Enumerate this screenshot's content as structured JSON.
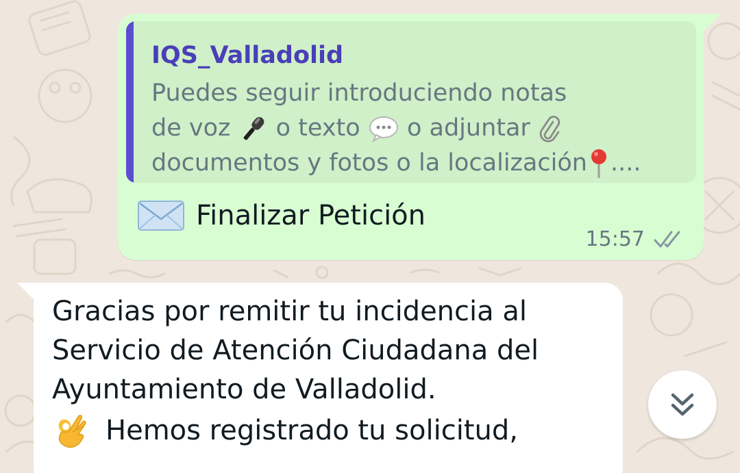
{
  "chat": {
    "outgoing": {
      "quoted_author": "IQS_Valladolid",
      "quoted_lines": [
        "Puedes seguir introduciendo notas",
        "de voz",
        "o texto",
        "o adjuntar",
        "documentos y fotos o la localización",
        "...."
      ],
      "message_text": "Finalizar Petición",
      "time": "15:57",
      "status_icon": "double-check-icon"
    },
    "incoming": {
      "lines": [
        "Gracias por remitir tu incidencia al",
        "Servicio de Atención Ciudadana del",
        "Ayuntamiento de Valladolid."
      ],
      "line2_text": "Hemos registrado tu solicitud,"
    },
    "scroll_button_icon": "double-chevron-down-icon"
  },
  "colors": {
    "outgoing_bubble": "#d9fdd3",
    "quote_bar": "#5a4ed1",
    "quote_author": "#4a3fb8",
    "incoming_bubble": "#ffffff",
    "wallpaper": "#efe7de"
  }
}
